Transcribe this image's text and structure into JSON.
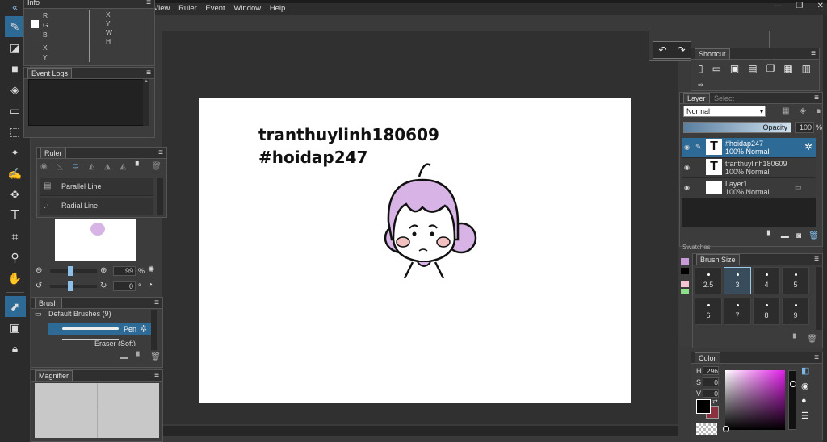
{
  "menubar": {
    "items": [
      "View",
      "Ruler",
      "Event",
      "Window",
      "Help"
    ]
  },
  "info_panel": {
    "title": "Info",
    "rgb_labels": [
      "R",
      "G",
      "B"
    ],
    "xy_labels": [
      "X",
      "Y"
    ],
    "xywh_labels": [
      "X",
      "Y",
      "W",
      "H"
    ]
  },
  "event_logs": {
    "title": "Event Logs"
  },
  "ruler_panel": {
    "title": "Ruler",
    "items": [
      "Parallel Line",
      "Radial Line"
    ]
  },
  "navigator": {
    "zoom_value": "99",
    "zoom_unit": "%",
    "rotate_value": "0",
    "rotate_unit": "°"
  },
  "brush_panel": {
    "title": "Brush",
    "group_label": "Default Brushes (9)",
    "items": [
      "Pen",
      "Eraser (Soft)"
    ]
  },
  "magnifier": {
    "title": "Magnifier"
  },
  "canvas": {
    "text_line1": "tranthuylinh180609",
    "text_line2": "#hoidap247"
  },
  "shortcut": {
    "title": "Shortcut"
  },
  "layer_panel": {
    "tabs": [
      "Layer",
      "Select"
    ],
    "blend_mode": "Normal",
    "opacity_label": "Opacity",
    "opacity_value": "100",
    "opacity_unit": "%",
    "layers": [
      {
        "name": "#hoidap247",
        "mode": "100% Normal",
        "type": "T"
      },
      {
        "name": "tranthuylinh180609",
        "mode": "100% Normal",
        "type": "T"
      },
      {
        "name": "Layer1",
        "mode": "100% Normal",
        "type": "img"
      }
    ]
  },
  "swatches": {
    "title": "Swatches"
  },
  "brush_size": {
    "title": "Brush Size",
    "sizes": [
      "2.5",
      "3",
      "4",
      "5",
      "6",
      "7",
      "8",
      "9"
    ]
  },
  "color_panel": {
    "title": "Color",
    "h_label": "H",
    "h_value": "296",
    "s_label": "S",
    "s_value": "0",
    "v_label": "V",
    "v_value": "0"
  },
  "colors": {
    "accent": "#2e6a96",
    "fg_color": "#000000",
    "bg_color": "#8c3040"
  }
}
